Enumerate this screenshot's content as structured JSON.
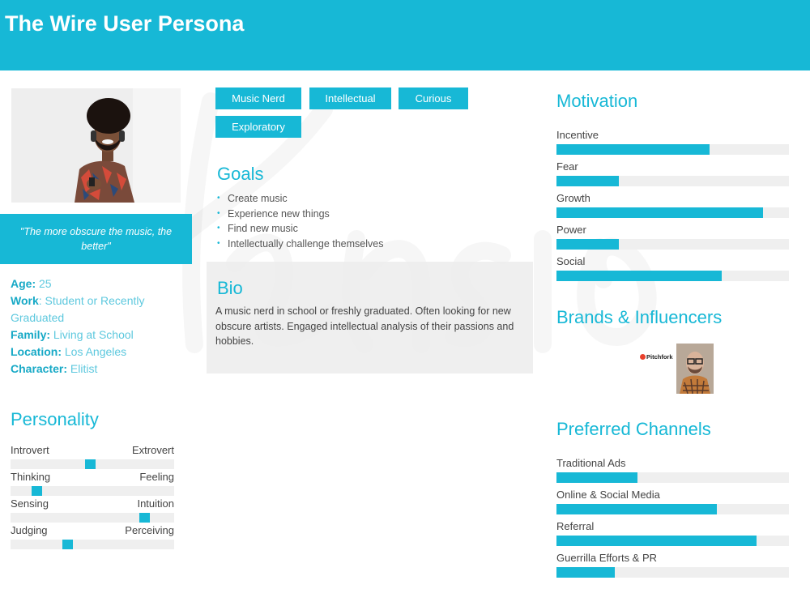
{
  "header": {
    "title": "The Wire User Persona"
  },
  "persona": {
    "photo_icon": "person-with-headphones-photo",
    "quote": "\"The more obscure the music, the better\"",
    "facts": [
      {
        "key": "Age:",
        "value": " 25"
      },
      {
        "key": "Work",
        "value": ": Student or Recently Graduated"
      },
      {
        "key": "Family:",
        "value": " Living at School"
      },
      {
        "key": "Location:",
        "value": " Los Angeles"
      },
      {
        "key": "Character:",
        "value": " Elitist"
      }
    ]
  },
  "personality": {
    "title": "Personality",
    "scales": [
      {
        "left": "Introvert",
        "right": "Extrovert",
        "value": 0.49
      },
      {
        "left": "Thinking",
        "right": "Feeling",
        "value": 0.16
      },
      {
        "left": "Sensing",
        "right": "Intuition",
        "value": 0.82
      },
      {
        "left": "Judging",
        "right": "Perceiving",
        "value": 0.35
      }
    ]
  },
  "tags": [
    "Music Nerd",
    "Intellectual",
    "Curious",
    "Exploratory"
  ],
  "goals": {
    "title": "Goals",
    "items": [
      "Create music",
      "Experience new things",
      "Find new music",
      "Intellectually challenge themselves"
    ]
  },
  "bio": {
    "title": "Bio",
    "text": "A music nerd in school or freshly graduated. Often looking for new obscure artists. Engaged intellectual analysis of their passions and hobbies."
  },
  "motivation": {
    "title": "Motivation",
    "items": [
      {
        "label": "Incentive",
        "value": 0.66
      },
      {
        "label": "Fear",
        "value": 0.27
      },
      {
        "label": "Growth",
        "value": 0.89
      },
      {
        "label": "Power",
        "value": 0.27
      },
      {
        "label": "Social",
        "value": 0.71
      }
    ]
  },
  "brands": {
    "title": "Brands & Influencers",
    "logo_text": "Pitchfork",
    "influencer_icon": "influencer-portrait-photo"
  },
  "channels": {
    "title": "Preferred Channels",
    "items": [
      {
        "label": "Traditional Ads",
        "value": 0.35
      },
      {
        "label": "Online & Social Media",
        "value": 0.69
      },
      {
        "label": "Referral",
        "value": 0.86
      },
      {
        "label": "Guerrilla Efforts & PR",
        "value": 0.25
      }
    ]
  },
  "colors": {
    "accent": "#17b8d6",
    "track": "#efefef",
    "bio_bg": "#ececec"
  }
}
